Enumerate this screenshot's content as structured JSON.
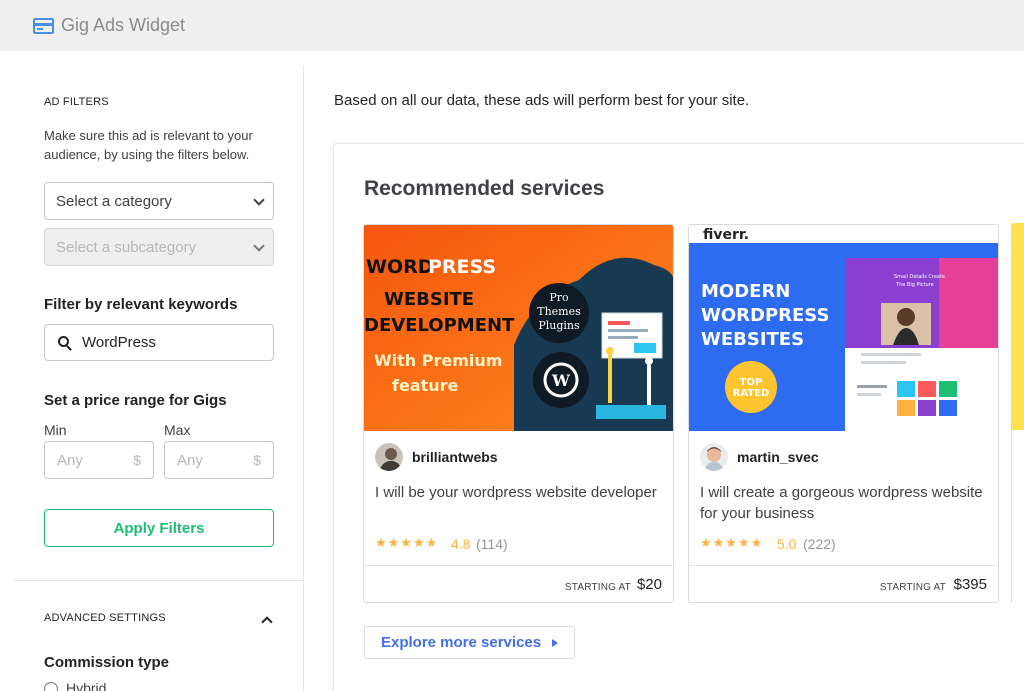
{
  "app": {
    "title": "Gig Ads Widget",
    "icon": "credit-card-icon"
  },
  "sidebar": {
    "filters_heading": "AD FILTERS",
    "filters_desc": "Make sure this ad is relevant to your audience, by using the filters below.",
    "category_placeholder": "Select a category",
    "subcategory_placeholder": "Select a subcategory",
    "keywords_heading": "Filter by relevant keywords",
    "keyword_value": "WordPress",
    "price_heading": "Set a price range for Gigs",
    "min_label": "Min",
    "max_label": "Max",
    "min_placeholder": "Any",
    "max_placeholder": "Any",
    "currency_symbol": "$",
    "apply_label": "Apply Filters",
    "advanced_heading": "ADVANCED SETTINGS",
    "commission_heading": "Commission type",
    "commission_option": "Hybrid"
  },
  "main": {
    "intro": "Based on all our data, these ads will perform best for your site.",
    "panel_title": "Recommended services",
    "explore_label": "Explore more services",
    "cards": [
      {
        "thumb": {
          "line1a": "WORD",
          "line1b": "PRESS",
          "line2": "WEBSITE",
          "line3": "DEVELOPMENT",
          "line4": "With Premium",
          "line5": "feature",
          "bubble1": "Pro",
          "bubble2": "Themes",
          "bubble3": "Plugins"
        },
        "seller": "brilliantwebs",
        "title": "I will be your wordpress website developer",
        "stars": "★★★★★",
        "rating": "4.8",
        "count": "(114)",
        "starting_label": "STARTING AT",
        "price": "$20"
      },
      {
        "thumb": {
          "brand": "fiverr.",
          "line1": "MODERN",
          "line2": "WORDPRESS",
          "line3": "WEBSITES",
          "badge1": "TOP",
          "badge2": "RATED",
          "mock1": "Small Details Create",
          "mock2": "The Big Picture"
        },
        "seller": "martin_svec",
        "title": "I will create a gorgeous wordpress website for your business",
        "stars": "★★★★★",
        "rating": "5.0",
        "count": "(222)",
        "starting_label": "STARTING AT",
        "price": "$395"
      }
    ]
  },
  "colors": {
    "green": "#1dbf73",
    "blue_link": "#446ee7",
    "star": "#ffb33e",
    "topbar": "#efeff0"
  }
}
